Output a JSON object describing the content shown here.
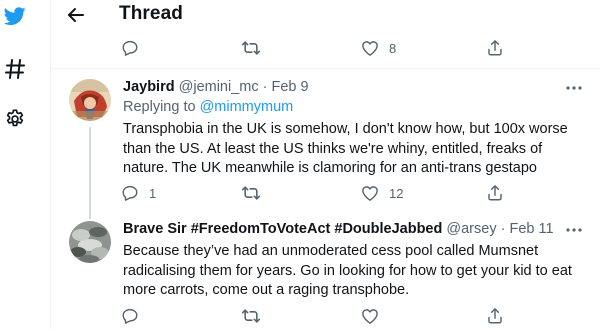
{
  "header": {
    "title": "Thread"
  },
  "top_actions": {
    "like_count": "8"
  },
  "tweets": [
    {
      "name": "Jaybird",
      "handle": "@jemini_mc",
      "dot": "·",
      "date": "Feb 9",
      "replying_prefix": "Replying to",
      "replying_to": "@mimmymum",
      "text": "Transphobia in the UK is somehow, I don't know how, but 100x worse than the US. At least the US thinks we're whiny, entitled, freaks of nature. The UK meanwhile is clamoring for an anti-trans gestapo",
      "reply_count": "1",
      "like_count": "12"
    },
    {
      "name": "Brave Sir #FreedomToVoteAct #DoubleJabbed",
      "handle": "@arsey",
      "dot": "·",
      "date": "Feb 11",
      "text": "Because they’ve had an unmoderated cess pool called Mumsnet radicalising them for years. Go in looking for how to get your kid to eat more carrots, come out a raging transphobe."
    }
  ],
  "colors": {
    "accent": "#1d9bf0",
    "muted": "#536471",
    "text": "#0f1419",
    "divider": "#eff3f4"
  },
  "icons": [
    "twitter-bird-icon",
    "hashtag-icon",
    "gear-icon",
    "back-arrow-icon",
    "reply-icon",
    "retweet-icon",
    "like-icon",
    "share-icon",
    "more-icon"
  ]
}
